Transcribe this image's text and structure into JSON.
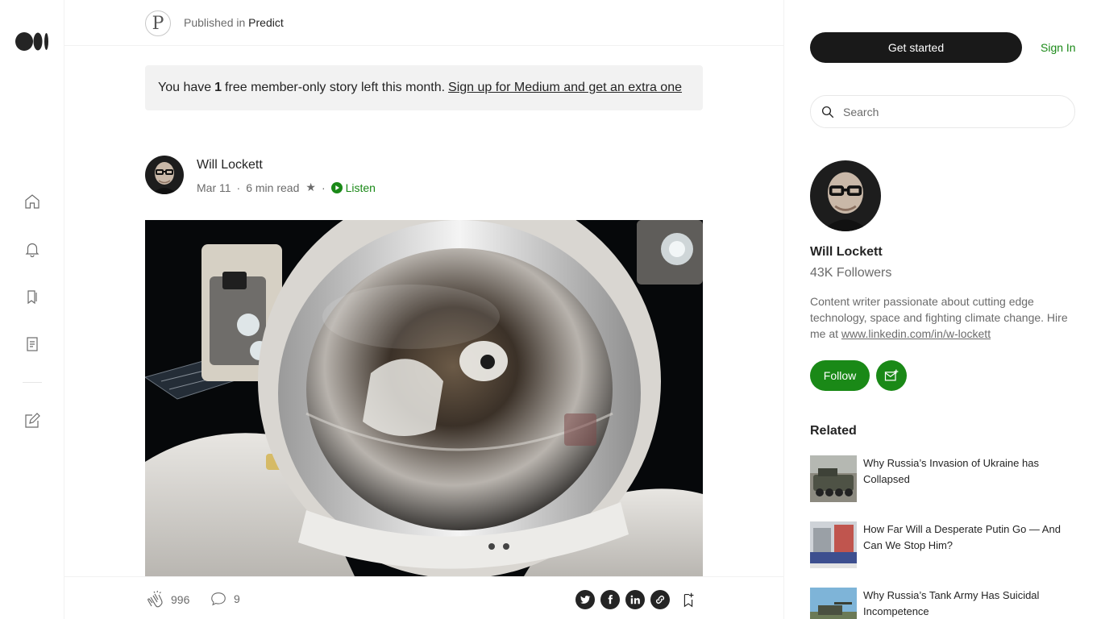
{
  "publication": {
    "logo_letter": "P",
    "prefix": "Published in",
    "name": "Predict"
  },
  "banner": {
    "text_before": "You have",
    "count": "1",
    "text_after": "free member-only story left this month.",
    "link": "Sign up for Medium and get an extra one"
  },
  "article": {
    "author": "Will Lockett",
    "date": "Mar 11",
    "read_time": "6 min read",
    "star": "★",
    "separator": "·",
    "listen": "Listen"
  },
  "actions": {
    "claps": "996",
    "responses": "9"
  },
  "sidebar": {
    "get_started": "Get started",
    "sign_in": "Sign In",
    "search_placeholder": "Search",
    "author_name": "Will Lockett",
    "followers": "43K Followers",
    "bio_text": "Content writer passionate about cutting edge technology, space and fighting climate change. Hire me at",
    "bio_link": "www.linkedin.com/in/w-lockett",
    "follow": "Follow",
    "related_title": "Related",
    "related": [
      {
        "title": "Why Russia’s Invasion of Ukraine has Collapsed"
      },
      {
        "title": "How Far Will a Desperate Putin Go — And Can We Stop Him?"
      },
      {
        "title": "Why Russia’s Tank Army Has Suicidal Incompetence"
      }
    ]
  },
  "colors": {
    "accent_green": "#1a8917",
    "dark": "#191919",
    "muted": "#6b6b6b",
    "banner_bg": "#f2f2f2"
  },
  "icons": {
    "rail": [
      "home-icon",
      "bell-icon",
      "bookmarks-icon",
      "stories-icon",
      "write-icon"
    ],
    "share": [
      "twitter-icon",
      "facebook-icon",
      "linkedin-icon",
      "link-icon"
    ]
  }
}
